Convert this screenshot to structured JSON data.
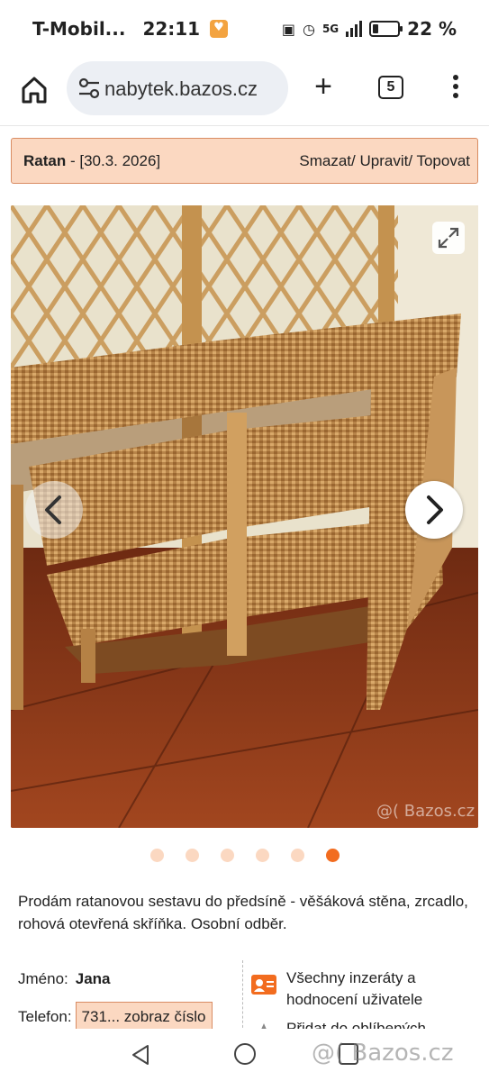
{
  "status_bar": {
    "carrier": "T-Mobil...",
    "time": "22:11",
    "network": "5G",
    "battery_percent": "22 %",
    "battery_level": 0.22
  },
  "browser": {
    "url": "nabytek.bazos.cz",
    "tab_count": "5"
  },
  "ad": {
    "title": "Ratan",
    "separator": " - ",
    "date": "[30.3. 2026]",
    "actions": "Smazat/ Upravit/ Topovat",
    "description": "Prodám ratanovou sestavu do předsíně - věšáková stěna, zrcadlo, rohová otevřená skříňka. Osobní odběr.",
    "photo_watermark": "@( Bazos.cz",
    "gallery": {
      "count": 6,
      "active_index": 5
    }
  },
  "seller": {
    "name_label": "Jméno:",
    "name": "Jana",
    "phone_label": "Telefon:",
    "phone_button": "731... zobraz číslo"
  },
  "links": {
    "all_ads": "Všechny inzeráty a hodnocení uživatele",
    "add_favorite": "Přidat do oblíbených"
  },
  "nav_watermark": "@( Bazos.cz",
  "colors": {
    "accent": "#f26c1f",
    "header_bg": "#fbd8c1",
    "header_border": "#d98c63"
  },
  "icons": [
    "home-icon",
    "tune-icon",
    "plus-icon",
    "tabs-icon",
    "more-vert-icon",
    "expand-icon",
    "chevron-left-icon",
    "chevron-right-icon",
    "user-card-icon",
    "star-icon"
  ]
}
